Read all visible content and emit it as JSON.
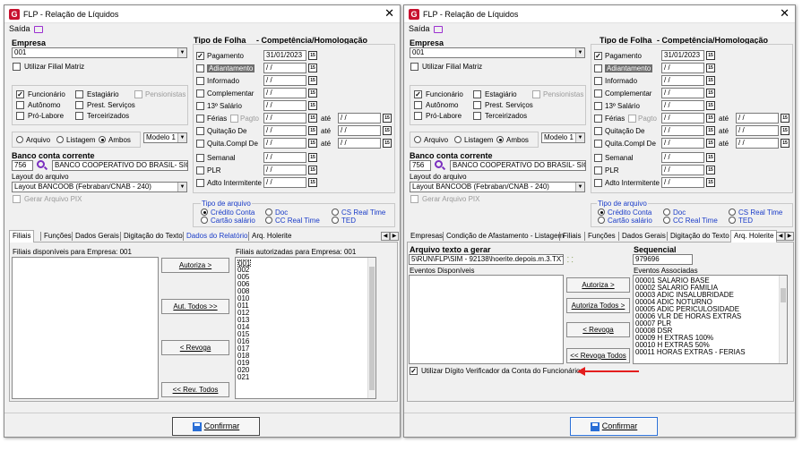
{
  "window_title": "FLP - Relação de Líquidos",
  "menu_saida": "Saída",
  "empresa": {
    "label": "Empresa",
    "value": "001"
  },
  "filial_matriz": "Utilizar Filial Matriz",
  "tipo_folha_header": "Tipo de Folha",
  "competencia_header": "Competência/Homologação",
  "tipos": {
    "pagamento": "Pagamento",
    "pagamento_date": "31/01/2023",
    "adiantamento": "Adiantamento",
    "informado": "Informado",
    "complementar": "Complementar",
    "salario13": "13º Salário",
    "ferias": "Férias",
    "pagto": "Pagto",
    "quitacao": "Quitação De",
    "quitacompl": "Quita.Compl De",
    "semanal": "Semanal",
    "plr": "PLR",
    "adto": "Adto Intermitente",
    "empty_date": "/ /",
    "ate": "até"
  },
  "categorias": {
    "funcionario": "Funcionário",
    "estagiario": "Estagiário",
    "pensionistas": "Pensionistas",
    "autonomo": "Autônomo",
    "prest": "Prest. Serviços",
    "prolabore": "Pró-Labore",
    "terceirizados": "Terceirizados"
  },
  "saida_opts": {
    "arquivo": "Arquivo",
    "listagem": "Listagem",
    "ambos": "Ambos"
  },
  "modelo": "Modelo 1",
  "banco": {
    "label": "Banco conta corrente",
    "code": "756",
    "name": "BANCO COOPERATIVO DO BRASIL- SICOO"
  },
  "layout": {
    "label": "Layout do arquivo",
    "value": "Layout BANCOOB (Febraban/CNAB - 240)"
  },
  "gerar_pix": "Gerar Arquivo PIX",
  "tipo_arquivo": {
    "label": "Tipo de arquivo",
    "credito": "Crédito Conta",
    "cartao": "Cartão salário",
    "doc": "Doc",
    "cc_real": "CC Real Time",
    "cs_real": "CS Real Time",
    "ted": "TED"
  },
  "left_tabs": [
    "Filiais",
    "Funções",
    "Dados Gerais",
    "Digitação do Texto",
    "Dados do Relatório",
    "Arq. Holerite"
  ],
  "right_tabs": [
    "Empresas",
    "Condição de Afastamento - Listagem",
    "Filiais",
    "Funções",
    "Dados Gerais",
    "Digitação do Texto",
    "Arq. Holerite"
  ],
  "filiais": {
    "disp_label": "Filiais disponíveis para Empresa: 001",
    "aut_label": "Filiais autorizadas para Empresa: 001",
    "items": [
      "001",
      "002",
      "005",
      "006",
      "008",
      "010",
      "011",
      "012",
      "013",
      "014",
      "015",
      "016",
      "017",
      "018",
      "019",
      "020",
      "021"
    ],
    "btn_autoriza": "Autoriza >",
    "btn_aut_todos": "Aut. Todos >>",
    "btn_revoga": "< Revoga",
    "btn_rev_todos": "<< Rev. Todos"
  },
  "holerite": {
    "arquivo_label": "Arquivo texto a gerar",
    "arquivo_value": "5\\RUN\\FLP\\SIM - 92138\\hoerite.depois.m.3.TXT",
    "seq_label": "Sequencial",
    "seq_value": "979696",
    "eventos_disp": "Eventos Disponíveis",
    "eventos_assoc": "Eventos Associadas",
    "eventos": [
      "00001 SALARIO BASE",
      "00002 SALARIO FAMILIA",
      "00003 ADIC INSALUBRIDADE",
      "00004 ADIC NOTURNO",
      "00005 ADIC PERICULOSIDADE",
      "00006 VLR DE HORAS EXTRAS",
      "00007 PLR",
      "00008 DSR",
      "00009 H EXTRAS 100%",
      "00010 H EXTRAS 50%",
      "00011 HORAS EXTRAS - FERIAS"
    ],
    "btn_autoriza": "Autoriza >",
    "btn_aut_todos": "Autoriza Todos >",
    "btn_revoga": "< Revoga",
    "btn_rev_todos": "<< Revoga Todos",
    "digito": "Utilizar Dígito Verificador da Conta do Funcionário"
  },
  "confirmar": "Confirmar",
  "colors": {
    "accent": "#e31d1d",
    "logo": "#c8102e",
    "link": "#1a3cc8"
  }
}
